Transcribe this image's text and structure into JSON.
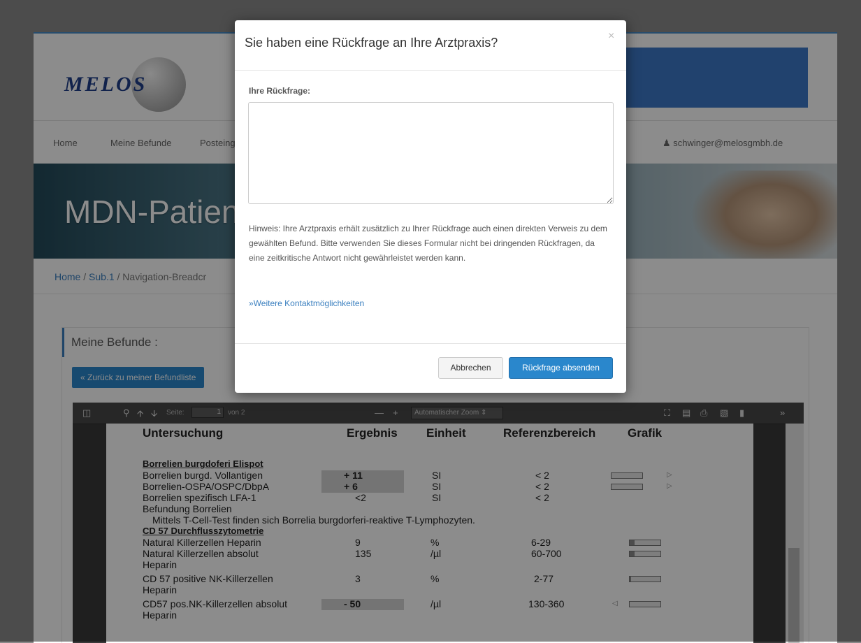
{
  "brand": {
    "logo_text": "MELOS"
  },
  "nav": {
    "items": [
      {
        "label": "Home"
      },
      {
        "label": "Meine Befunde"
      },
      {
        "label": "Posteing"
      }
    ],
    "user_email": "schwinger@melosgmbh.de",
    "user_icon": "user-icon"
  },
  "hero": {
    "title": "MDN-Patien"
  },
  "breadcrumb": {
    "home": "Home",
    "sep1": "/",
    "sub": "Sub.1",
    "sep2": "/",
    "current": "Navigation-Breadcr"
  },
  "panel": {
    "title": "Meine Befunde :",
    "back_button": "« Zurück zu meiner Befundliste"
  },
  "viewer": {
    "page_label": "Seite:",
    "page_value": "1",
    "page_total": "von 2",
    "zoom_label": "Automatischer Zoom",
    "icons": [
      "sidebar-toggle-icon",
      "search-icon",
      "prev-page-icon",
      "next-page-icon",
      "zoom-out-icon",
      "zoom-in-icon",
      "fullscreen-icon",
      "open-file-icon",
      "print-icon",
      "download-icon",
      "bookmark-icon",
      "tools-icon"
    ]
  },
  "report": {
    "headers": {
      "test": "Untersuchung",
      "result": "Ergebnis",
      "unit": "Einheit",
      "reference": "Referenzbereich",
      "graph": "Grafik"
    },
    "section1": "Borrelien burgdoferi Elispot",
    "rows1": [
      {
        "test": "Borrelien burgd. Vollantigen",
        "result": "+ 11",
        "unit": "SI",
        "reference": "< 2",
        "flag": "high",
        "bar_fill": 0
      },
      {
        "test": "Borrelien-OSPA/OSPC/DbpA",
        "result": "+ 6",
        "unit": "SI",
        "reference": "< 2",
        "flag": "high",
        "bar_fill": 0
      },
      {
        "test": "Borrelien spezifisch LFA-1",
        "result": "<2",
        "unit": "SI",
        "reference": "< 2",
        "flag": "normal"
      }
    ],
    "befundung_label": "Befundung Borrelien",
    "befundung_text": "Mittels T-Cell-Test finden sich Borrelia burgdorferi-reaktive T-Lymphozyten.",
    "section2": "CD 57 Durchflusszytometrie",
    "rows2": [
      {
        "test": "Natural Killerzellen Heparin",
        "test2": "",
        "result": "9",
        "unit": "%",
        "reference": "6-29",
        "flag": "normal",
        "bar_fill": 0.15
      },
      {
        "test": "Natural Killerzellen absolut",
        "test2": "Heparin",
        "result": "135",
        "unit": "/µl",
        "reference": "60-700",
        "flag": "normal",
        "bar_fill": 0.15
      },
      {
        "test": "CD 57 positive NK-Killerzellen",
        "test2": "Heparin",
        "result": "3",
        "unit": "%",
        "reference": "2-77",
        "flag": "normal",
        "bar_fill": 0.02
      },
      {
        "test": "CD57 pos.NK-Killerzellen absolut",
        "test2": "Heparin",
        "result": "- 50",
        "unit": "/µl",
        "reference": "130-360",
        "flag": "low",
        "bar_fill": 0
      }
    ]
  },
  "modal": {
    "title": "Sie haben eine Rückfrage an Ihre Arztpraxis?",
    "close": "×",
    "field_label": "Ihre Rückfrage:",
    "textarea_value": "",
    "note": "Hinweis: Ihre Arztpraxis erhält zusätzlich zu Ihrer Rückfrage auch einen direkten Verweis zu dem gewählten Befund. Bitte verwenden Sie dieses Formular nicht bei dringenden Rückfragen, da eine zeitkritische Antwort nicht gewährleistet werden kann.",
    "link": "»Weitere Kontaktmöglichkeiten",
    "cancel": "Abbrechen",
    "submit": "Rückfrage absenden",
    "submit_color": "#2a87cc"
  }
}
